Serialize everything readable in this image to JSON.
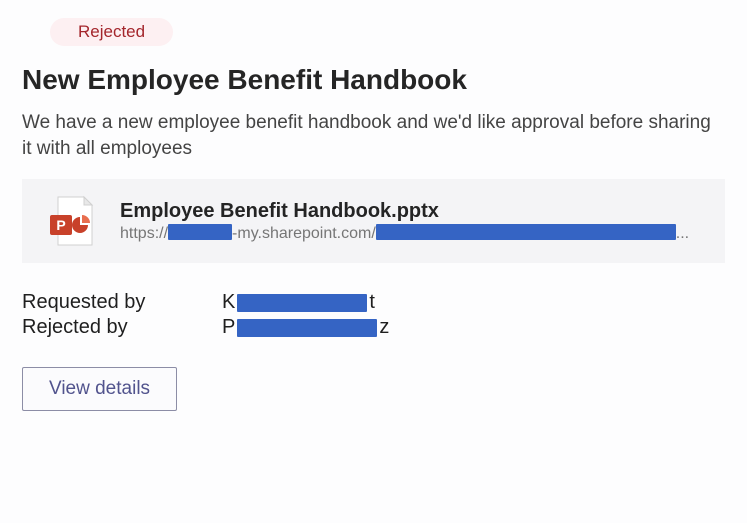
{
  "status": {
    "label": "Rejected"
  },
  "title": "New Employee Benefit Handbook",
  "description": "We have a new employee benefit handbook and we'd like approval before sharing it with all employees",
  "attachment": {
    "name": "Employee Benefit Handbook.pptx",
    "url_prefix": "https://",
    "url_mid": "-my.sharepoint.com/",
    "url_suffix": "..."
  },
  "meta": {
    "requested_by_label": "Requested by",
    "rejected_by_label": "Rejected by",
    "requested_prefix": "K",
    "requested_suffix": "t",
    "rejected_prefix": "P",
    "rejected_suffix": "z"
  },
  "buttons": {
    "view_details": "View details"
  }
}
